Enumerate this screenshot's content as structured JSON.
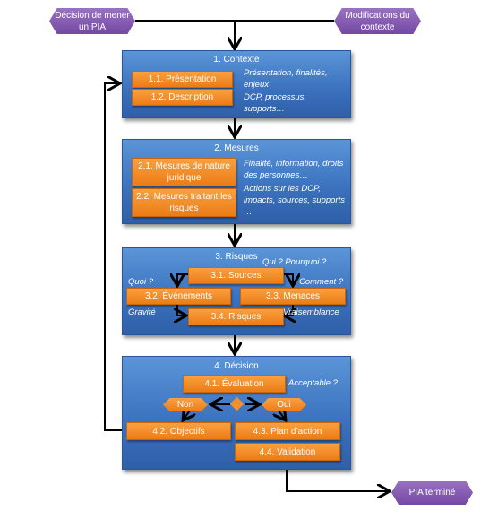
{
  "start": {
    "left": "Décision de mener un PIA",
    "right": "Modifications du contexte"
  },
  "end": "PIA terminé",
  "phase1": {
    "title": "1. Contexte",
    "items": [
      "1.1. Présentation",
      "1.2. Description"
    ],
    "notes": [
      "Présentation, finalités, enjeux",
      "DCP, processus, supports…"
    ]
  },
  "phase2": {
    "title": "2. Mesures",
    "items": [
      "2.1. Mesures de nature juridique",
      "2.2. Mesures traitant les risques"
    ],
    "notes": [
      "Finalité, information, droits des personnes…",
      "Actions sur les DCP, impacts, sources, supports …"
    ]
  },
  "phase3": {
    "title": "3. Risques",
    "items": [
      "3.1. Sources",
      "3.2. Événements",
      "3.3. Menaces",
      "3.4. Risques"
    ],
    "notes": [
      "Qui ? Pourquoi ?",
      "Quoi ?",
      "Comment ?",
      "Gravité",
      "Vraisemblance"
    ]
  },
  "phase4": {
    "title": "4. Décision",
    "items": [
      "4.1. Évaluation",
      "4.2. Objectifs",
      "4.3. Plan d’action",
      "4.4. Validation"
    ],
    "question": "Acceptable ?",
    "no": "Non",
    "yes": "Oui"
  },
  "colors": {
    "phase": "#3a70bd",
    "step": "#ec7c16",
    "terminal": "#7449a3"
  }
}
